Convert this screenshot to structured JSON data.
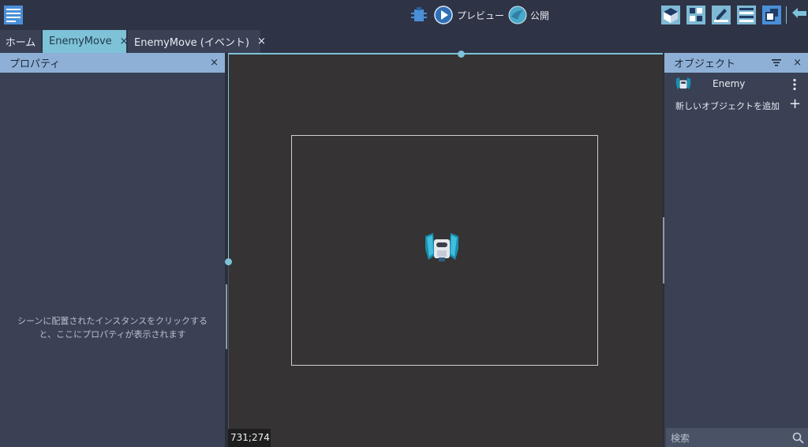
{
  "toolbar": {
    "preview_label": "プレビュー",
    "publish_label": "公開"
  },
  "tabs": [
    {
      "label": "ホーム"
    },
    {
      "label": "EnemyMove",
      "close": "×"
    },
    {
      "label": "EnemyMove (イベント)",
      "close": "×"
    }
  ],
  "properties_panel": {
    "title": "プロパティ",
    "close": "×",
    "empty_line1": "シーンに配置されたインスタンスをクリックする",
    "empty_line2": "と、ここにプロパティが表示されます"
  },
  "scene": {
    "cursor_coords": "731;274"
  },
  "objects_panel": {
    "title": "オブジェクト",
    "close": "×",
    "items": [
      {
        "label": "Enemy"
      }
    ],
    "add_label": "新しいオブジェクトを追加",
    "add_icon": "+",
    "search_placeholder": "検索"
  },
  "colors": {
    "accent": "#7ec2d8",
    "header": "#8fb0d6",
    "panel": "#3a4155",
    "bar": "#2e3446",
    "scene": "#353333"
  }
}
